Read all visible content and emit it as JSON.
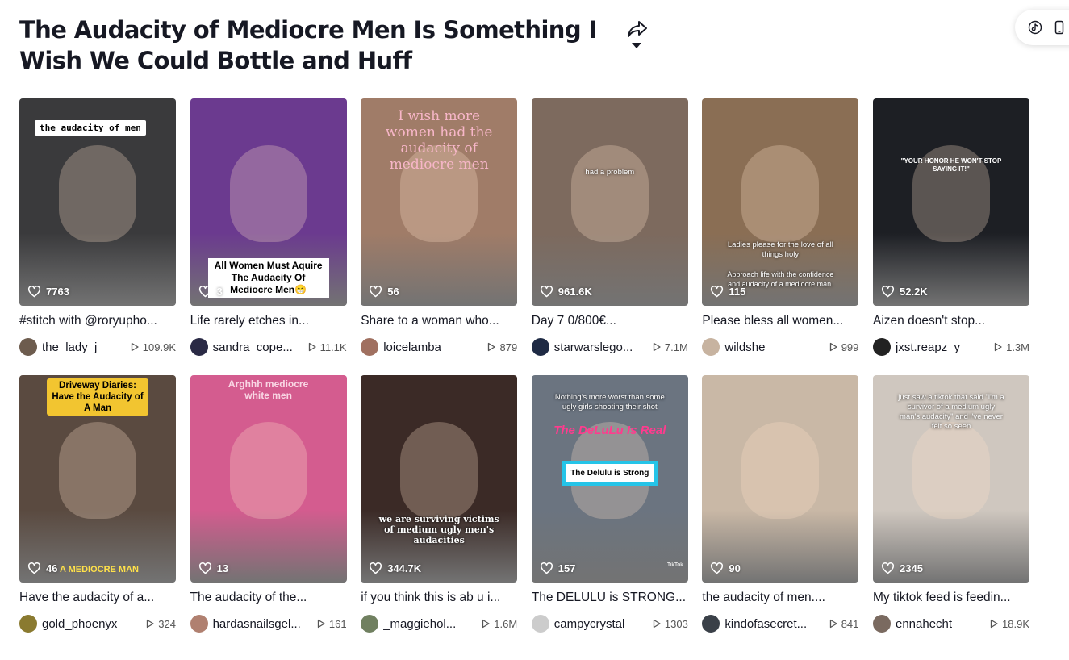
{
  "page": {
    "title": "The Audacity of Mediocre Men Is Something I Wish We Could Bottle and Huff"
  },
  "videos": [
    {
      "caption": "#stitch with @roryupho...",
      "user": "the_lady_j_",
      "plays": "109.9K",
      "likes": "7763",
      "overlay": "the audacity of men"
    },
    {
      "caption": "Life rarely etches in...",
      "user": "sandra_cope...",
      "plays": "11.1K",
      "likes": "3",
      "overlay": "All Women Must Aquire The Audacity Of Mediocre Men😁"
    },
    {
      "caption": "Share to a woman who...",
      "user": "loicelamba",
      "plays": "879",
      "likes": "56",
      "overlay": "I wish more women had the audacity of mediocre men"
    },
    {
      "caption": "Day 7 0/800€...",
      "user": "starwarslego...",
      "plays": "7.1M",
      "likes": "961.6K",
      "overlay": "had a problem"
    },
    {
      "caption": "Please bless all women...",
      "user": "wildshe_",
      "plays": "999",
      "likes": "115",
      "overlay": "Ladies please for the love of all things holy",
      "overlay2": "Approach life with the confidence and audacity of a mediocre man."
    },
    {
      "caption": "Aizen doesn't stop...",
      "user": "jxst.reapz_y",
      "plays": "1.3M",
      "likes": "52.2K",
      "overlay": "\"YOUR HONOR HE WON'T STOP SAYING IT!\""
    },
    {
      "caption": "Have the audacity of a...",
      "user": "gold_phoenyx",
      "plays": "324",
      "likes": "46",
      "overlay": "Driveway Diaries: Have the Audacity of A Man",
      "overlay2": "A MEDIOCRE MAN"
    },
    {
      "caption": "The audacity of the...",
      "user": "hardasnailsgel...",
      "plays": "161",
      "likes": "13",
      "overlay": "Arghhh mediocre white men"
    },
    {
      "caption": "if you think this is ab u i...",
      "user": "_maggiehol...",
      "plays": "1.6M",
      "likes": "344.7K",
      "overlay": "we are surviving victims of medium ugly men's audacities"
    },
    {
      "caption": "The DELULU is STRONG...",
      "user": "campycrystal",
      "plays": "1303",
      "likes": "157",
      "overlay": "Nothing's more worst than some ugly girls shooting their shot",
      "overlay2": "The DeLuLu Is Real",
      "overlay3": "The Delulu is Strong",
      "overlay4": "TikTok"
    },
    {
      "caption": "the audacity of men....",
      "user": "kindofasecret...",
      "plays": "841",
      "likes": "90",
      "overlay": ""
    },
    {
      "caption": "My tiktok feed is feedin...",
      "user": "ennahecht",
      "plays": "18.9K",
      "likes": "2345",
      "overlay": "just saw a tiktok that said \"i'm a survivor of a medium ugly man's audacity\" and i've never felt so seen"
    }
  ],
  "theme": {
    "thumb_bg": [
      "#3a3a3c",
      "#6b3a8f",
      "#a07c68",
      "#7d6a5e",
      "#8a6e54",
      "#1d1f24",
      "#5a4a40",
      "#d45c8f",
      "#3b2a26",
      "#6b7480",
      "#c9b8a6",
      "#cfc7bf"
    ],
    "avatar_bg": [
      "#6d5c4e",
      "#2a2a45",
      "#a07060",
      "#1e2a44",
      "#c7b3a0",
      "#222222",
      "#8a7a30",
      "#b08070",
      "#708060",
      "#cccccc",
      "#3a4048",
      "#7a6a60"
    ]
  },
  "icons": {
    "share": "share-arrow-icon",
    "dropdown": "caret-down-icon",
    "like": "heart-icon",
    "play": "play-icon",
    "tiktok": "tiktok-logo-icon",
    "device": "phone-icon"
  }
}
